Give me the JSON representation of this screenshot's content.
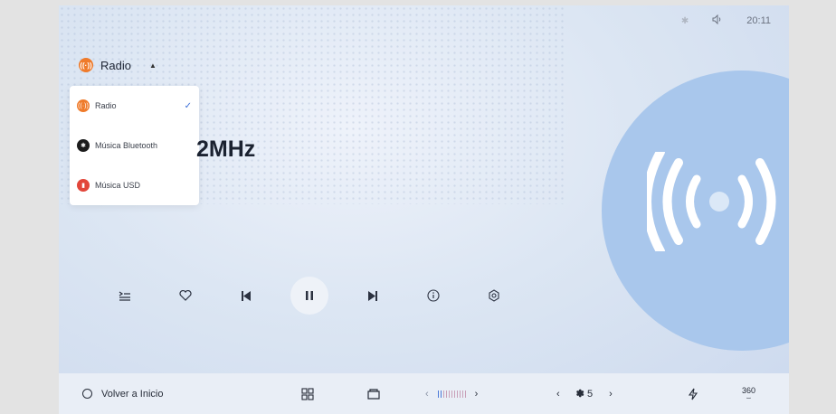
{
  "status": {
    "bluetooth_icon": "bluetooth-icon",
    "volume_icon": "volume-icon",
    "time": "20:11"
  },
  "source": {
    "label": "Radio",
    "icon": "radio-icon"
  },
  "dropdown": {
    "items": [
      {
        "label": "Radio",
        "icon": "radio-icon",
        "color": "#ef7b2b",
        "selected": true
      },
      {
        "label": "Música Bluetooth",
        "icon": "bluetooth-icon",
        "color": "#1c1c1c",
        "selected": false
      },
      {
        "label": "Música USD",
        "icon": "usb-icon",
        "color": "#e2463a",
        "selected": false
      }
    ]
  },
  "frequency": "2MHz",
  "controls": [
    "list-icon",
    "heart-icon",
    "previous-icon",
    "pause-icon",
    "next-icon",
    "info-icon",
    "settings-icon"
  ],
  "bottom": {
    "home_label": "Volver a Inicio",
    "fan_level": "5",
    "angle_label": "360"
  }
}
